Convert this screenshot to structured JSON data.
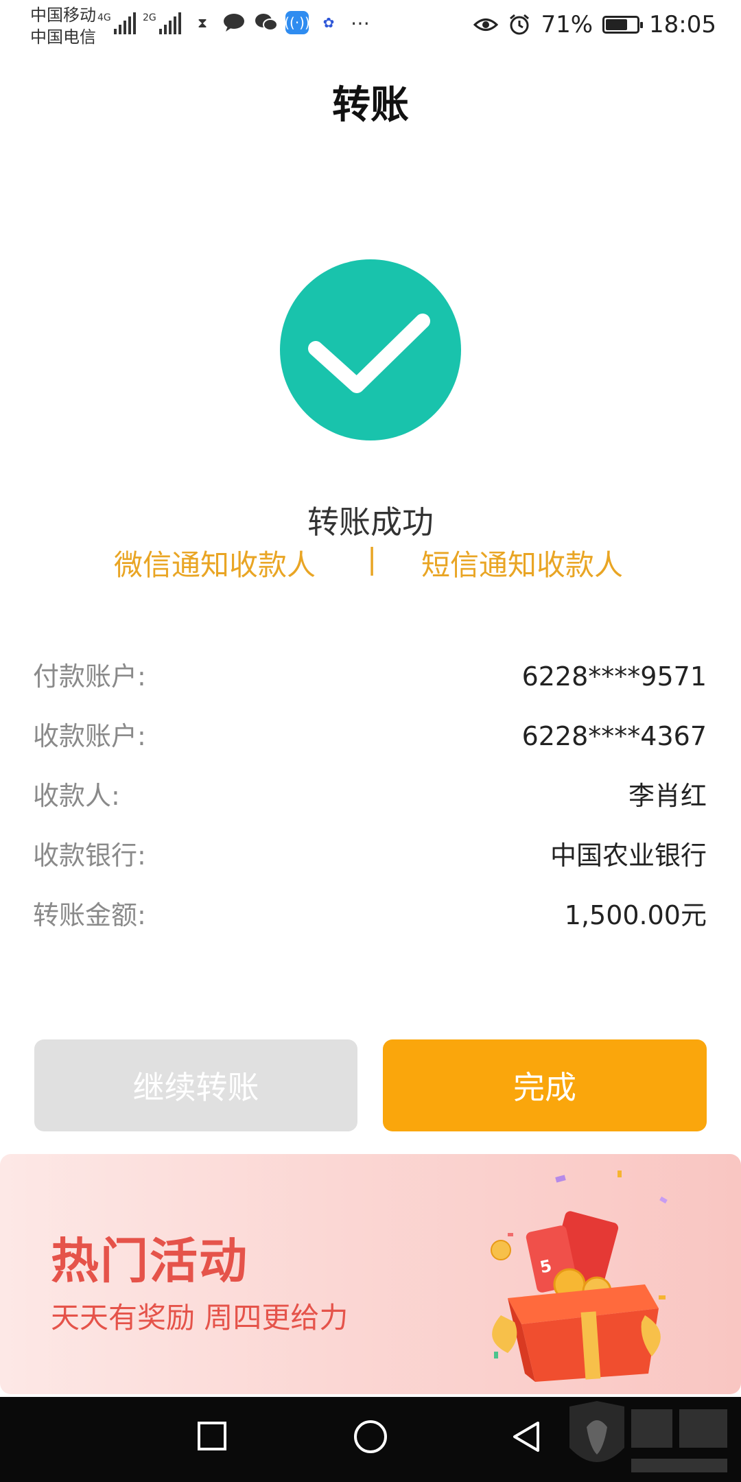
{
  "status_bar": {
    "carrier1": "中国移动",
    "carrier2": "中国电信",
    "sig1_label": "4G",
    "sig2_label": "2G",
    "battery": "71%",
    "battery_level": 0.71,
    "time": "18:05"
  },
  "header": {
    "title": "转账"
  },
  "result": {
    "status_text": "转账成功",
    "wechat_notify": "微信通知收款人",
    "separator": "|",
    "sms_notify": "短信通知收款人"
  },
  "details": [
    {
      "label": "付款账户:",
      "value": "6228****9571"
    },
    {
      "label": "收款账户:",
      "value": "6228****4367"
    },
    {
      "label": "收款人:",
      "value": "李肖红"
    },
    {
      "label": "收款银行:",
      "value": "中国农业银行"
    },
    {
      "label": "转账金额:",
      "value": "1,500.00元"
    }
  ],
  "actions": {
    "continue_label": "继续转账",
    "done_label": "完成"
  },
  "banner": {
    "title": "热门活动",
    "subtitle": "天天有奖励  周四更给力"
  },
  "colors": {
    "success": "#19c3ac",
    "accent_orange": "#faa60c",
    "notify_gold": "#e9a524",
    "banner_red": "#e5534a"
  }
}
